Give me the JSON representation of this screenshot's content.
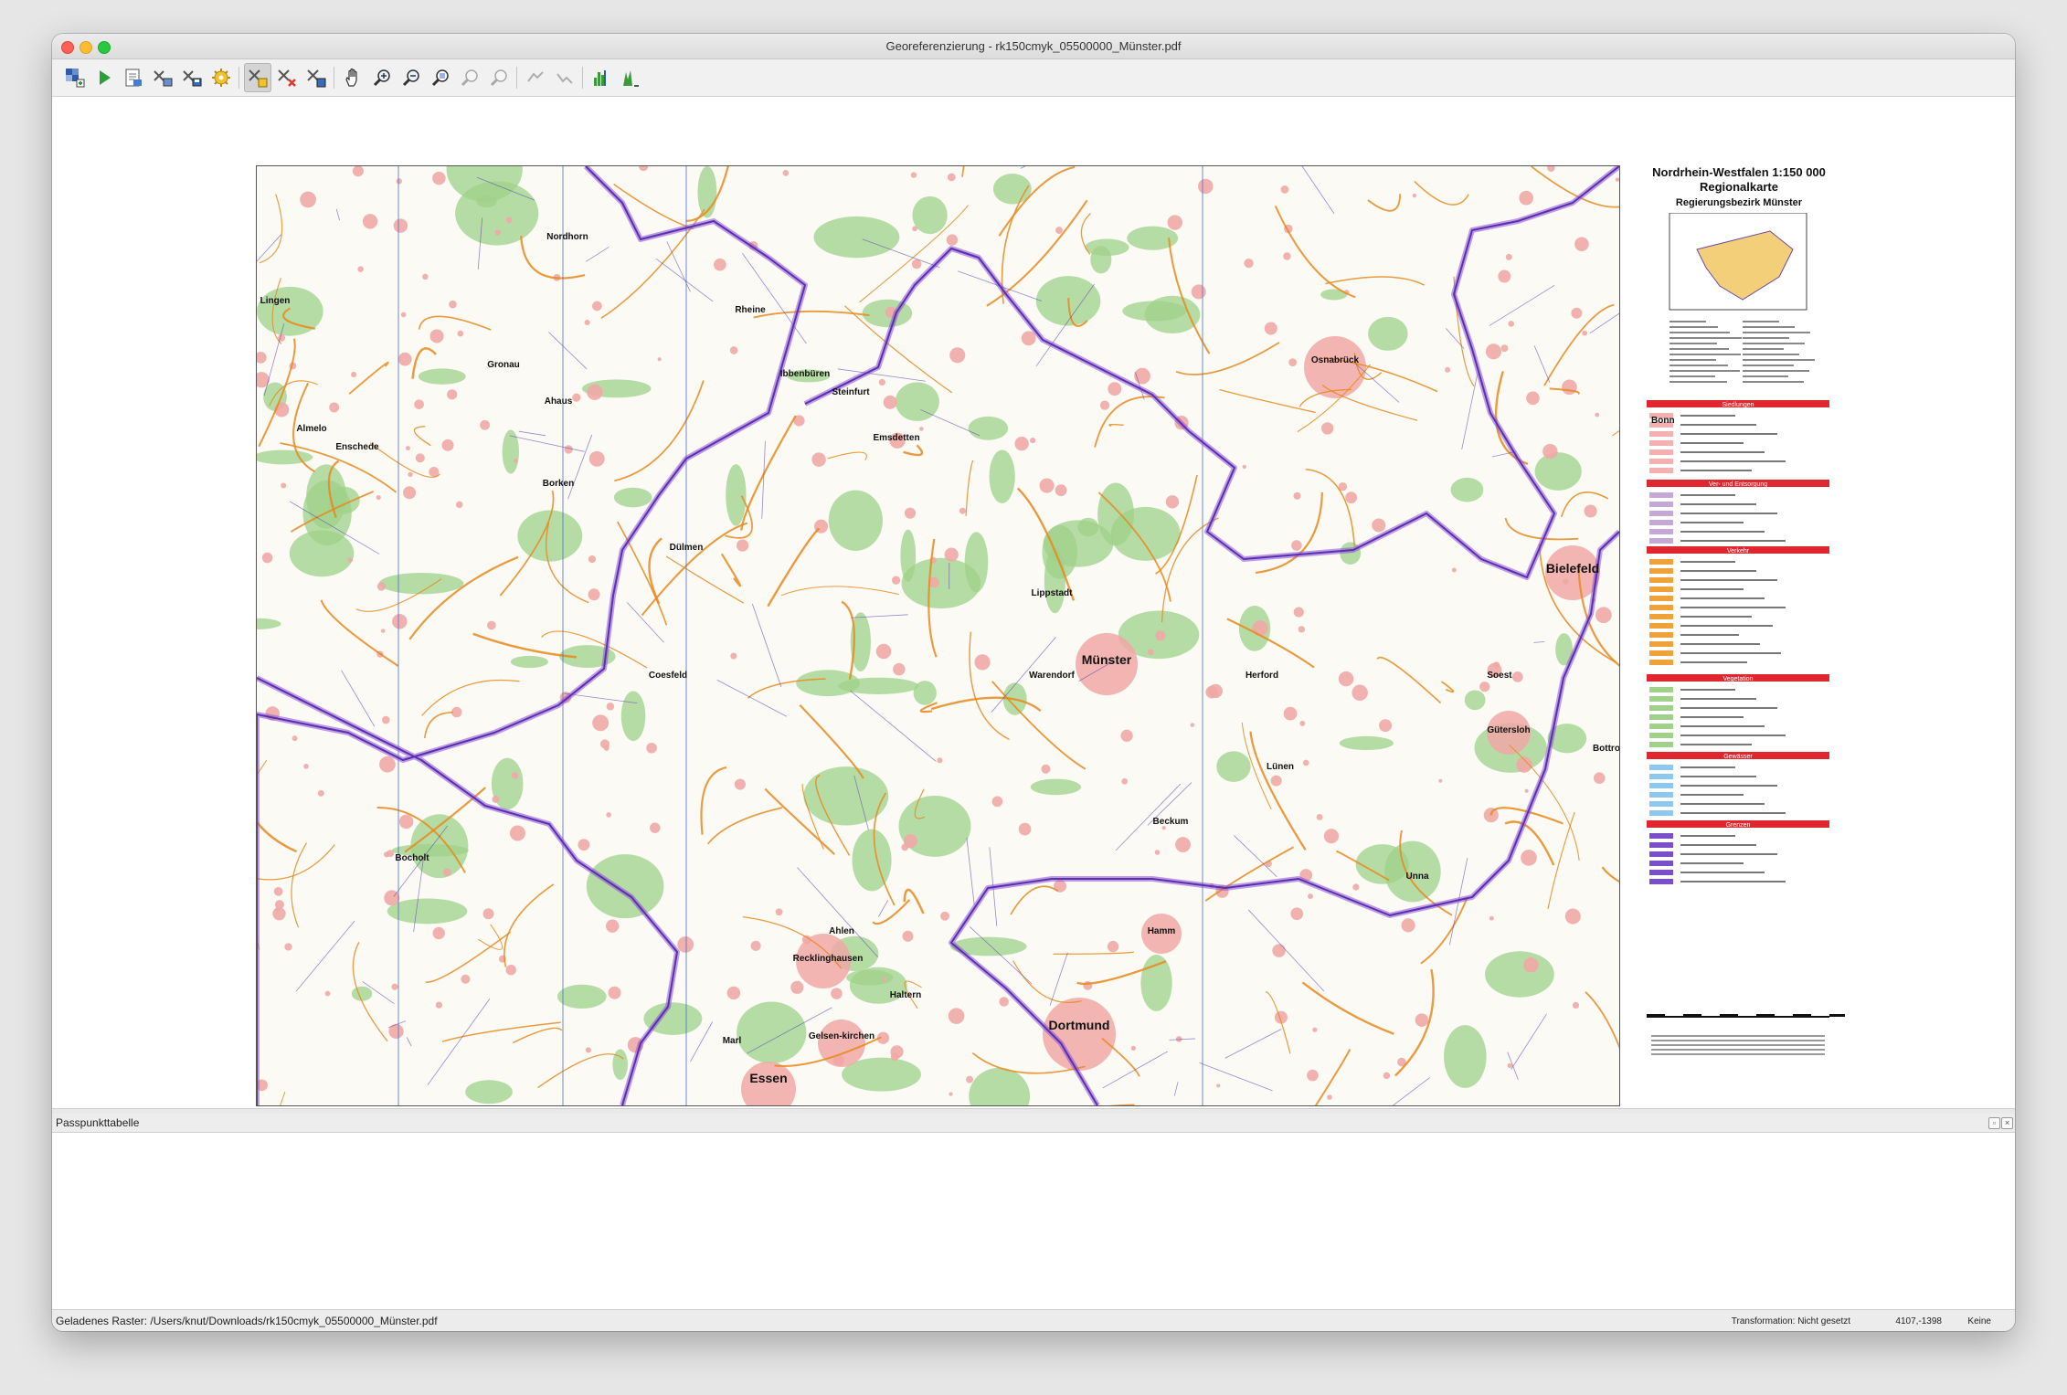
{
  "window": {
    "title": "Georeferenzierung - rk150cmyk_05500000_Münster.pdf"
  },
  "toolbar": {
    "buttons": [
      {
        "name": "open-raster",
        "icon": "open-raster-icon"
      },
      {
        "name": "start-georeferencing",
        "icon": "play-icon"
      },
      {
        "name": "generate-gdal-script",
        "icon": "script-icon"
      },
      {
        "name": "load-gcp-points",
        "icon": "load-points-icon"
      },
      {
        "name": "save-gcp-points",
        "icon": "save-points-icon"
      },
      {
        "name": "transformation-settings",
        "icon": "gear-icon"
      },
      {
        "name": "add-point",
        "icon": "add-point-icon",
        "active": true
      },
      {
        "name": "delete-point",
        "icon": "delete-point-icon"
      },
      {
        "name": "move-gcp-point",
        "icon": "move-point-icon"
      },
      {
        "name": "pan",
        "icon": "hand-icon"
      },
      {
        "name": "zoom-in",
        "icon": "zoom-in-icon"
      },
      {
        "name": "zoom-out",
        "icon": "zoom-out-icon"
      },
      {
        "name": "zoom-to-layer",
        "icon": "zoom-layer-icon"
      },
      {
        "name": "zoom-last",
        "icon": "zoom-last-icon",
        "disabled": true
      },
      {
        "name": "zoom-next",
        "icon": "zoom-next-icon",
        "disabled": true
      },
      {
        "name": "link-georef-to-qgis",
        "icon": "link-georef-icon",
        "disabled": true
      },
      {
        "name": "link-qgis-to-georef",
        "icon": "link-qgis-icon",
        "disabled": true
      },
      {
        "name": "full-histogram-stretch",
        "icon": "histogram-full-icon"
      },
      {
        "name": "local-histogram-stretch",
        "icon": "histogram-local-icon"
      }
    ]
  },
  "map": {
    "city_labels": [
      "Münster",
      "Dortmund",
      "Essen",
      "Bielefeld",
      "Gelsen-kirchen",
      "Recklinghausen",
      "Osnabrück",
      "Gütersloh",
      "Hamm",
      "Bocholt",
      "Dülmen",
      "Coesfeld",
      "Ahaus",
      "Borken",
      "Gronau",
      "Nordhorn",
      "Lingen",
      "Almelo",
      "Enschede",
      "Rheine",
      "Ibbenbüren",
      "Warendorf",
      "Lünen",
      "Unna",
      "Soest",
      "Lippstadt",
      "Ahlen",
      "Haltern",
      "Marl",
      "Bottrop",
      "Herford",
      "Beckum",
      "Emsdetten",
      "Steinfurt"
    ],
    "accent_colors": {
      "border": "#8a4fd6",
      "settlement": "#f0a8a6",
      "forest": "#9fd18a",
      "road": "#e88a1f"
    }
  },
  "legend": {
    "title": "Nordrhein-Westfalen 1:150 000",
    "subtitle": "Regionalkarte",
    "region": "Regierungsbezirk Münster",
    "sections": [
      "Siedlungen",
      "Ver- und Entsorgung",
      "Verkehr",
      "Vegetation",
      "Gewässer",
      "Grenzen"
    ],
    "sample_label": "Bonn"
  },
  "panel": {
    "title": "Passpunkttabelle"
  },
  "status": {
    "raster": "Geladenes Raster: /Users/knut/Downloads/rk150cmyk_05500000_Münster.pdf",
    "transformation": "Transformation: Nicht gesetzt",
    "coords": "4107,-1398",
    "crs": "Keine"
  }
}
